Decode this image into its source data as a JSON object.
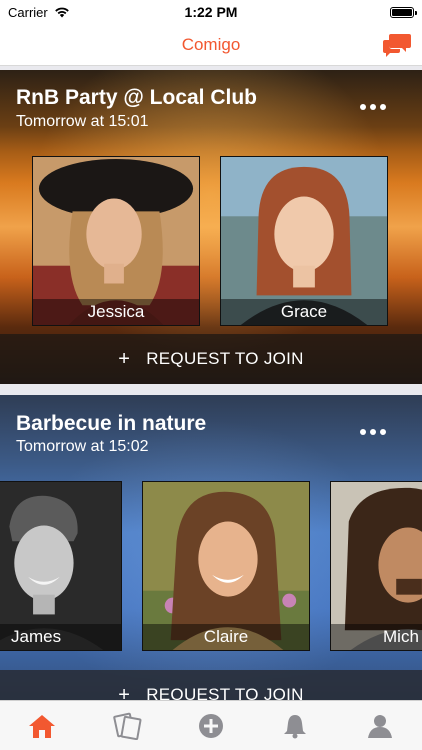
{
  "status_bar": {
    "carrier": "Carrier",
    "time": "1:22 PM"
  },
  "nav": {
    "title": "Comigo"
  },
  "events": [
    {
      "title": "RnB Party @ Local Club",
      "time": "Tomorrow at 15:01",
      "attendees": [
        "Jessica",
        "Grace"
      ],
      "join_label": "REQUEST TO JOIN"
    },
    {
      "title": "Barbecue in nature",
      "time": "Tomorrow at 15:02",
      "attendees": [
        "James",
        "Claire",
        "Mich"
      ],
      "join_label": "REQUEST TO JOIN"
    }
  ],
  "join_plus": "+",
  "tabs": [
    "home-icon",
    "cards-icon",
    "add-icon",
    "bell-icon",
    "profile-icon"
  ],
  "colors": {
    "accent": "#f25830",
    "tab_inactive": "#8e8e93"
  }
}
